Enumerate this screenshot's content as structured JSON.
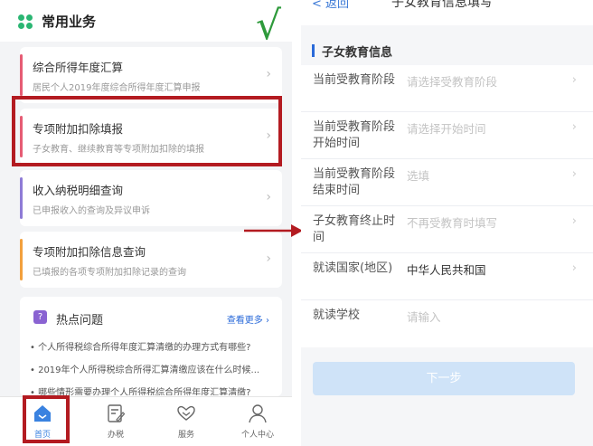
{
  "left": {
    "header_title": "常用业务",
    "cards": [
      {
        "title": "综合所得年度汇算",
        "subtitle": "居民个人2019年度综合所得年度汇算申报",
        "accent": "#e65c74"
      },
      {
        "title": "专项附加扣除填报",
        "subtitle": "子女教育、继续教育等专项附加扣除的填报",
        "accent": "#e65c74"
      },
      {
        "title": "收入纳税明细查询",
        "subtitle": "已申报收入的查询及异议申诉",
        "accent": "#8e7bd6"
      },
      {
        "title": "专项附加扣除信息查询",
        "subtitle": "已填报的各项专项附加扣除记录的查询",
        "accent": "#f2a03d"
      }
    ],
    "hot": {
      "title": "热点问题",
      "more": "查看更多",
      "questions": [
        "• 个人所得税综合所得年度汇算清缴的办理方式有哪些?",
        "• 2019年个人所得税综合所得汇算清缴应该在什么时候...",
        "• 哪些情形需要办理个人所得税综合所得年度汇算清缴?"
      ]
    },
    "tabs": [
      "首页",
      "办税",
      "服务",
      "个人中心"
    ]
  },
  "annotation": {
    "check": "√",
    "highlight_color": "#b31b21"
  },
  "right": {
    "nav_back": "< 返回",
    "nav_title": "子女教育信息填写",
    "section_title": "子女教育信息",
    "rows": [
      {
        "label": "当前受教育阶段",
        "value": "请选择受教育阶段",
        "filled": false
      },
      {
        "label": "当前受教育阶段开始时间",
        "value": "请选择开始时间",
        "filled": false
      },
      {
        "label": "当前受教育阶段结束时间",
        "value": "选填",
        "filled": false
      },
      {
        "label": "子女教育终止时间",
        "value": "不再受教育时填写",
        "filled": false
      },
      {
        "label": "就读国家(地区)",
        "value": "中华人民共和国",
        "filled": true
      },
      {
        "label": "就读学校",
        "value": "请输入",
        "filled": false
      }
    ],
    "next_button": "下一步"
  }
}
